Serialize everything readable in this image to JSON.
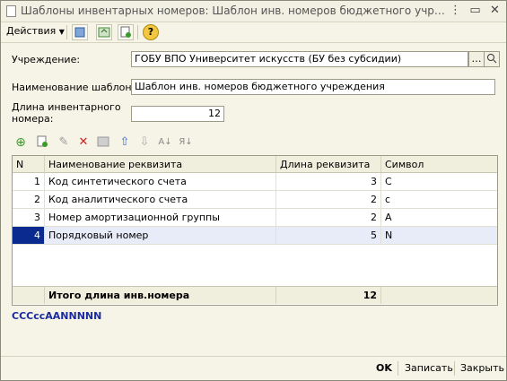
{
  "window": {
    "title": "Шаблоны инвентарных номеров: Шаблон инв. номеров бюджетного учрежден..."
  },
  "toolbar": {
    "actions_label": "Действия"
  },
  "form": {
    "institution_label": "Учреждение:",
    "institution_value": "ГОБУ ВПО Университет искусств (БУ без субсидии)",
    "template_name_label": "Наименование шаблона:",
    "template_name_value": "Шаблон инв. номеров бюджетного учреждения",
    "length_label_line1": "Длина инвентарного",
    "length_label_line2": "номера:",
    "length_value": "12"
  },
  "table": {
    "columns": [
      "N",
      "Наименование реквизита",
      "Длина реквизита",
      "Символ"
    ],
    "rows": [
      {
        "n": "1",
        "name": "Код синтетического счета",
        "length": "3",
        "symbol": "С"
      },
      {
        "n": "2",
        "name": "Код аналитического счета",
        "length": "2",
        "symbol": "с"
      },
      {
        "n": "3",
        "name": "Номер амортизационной группы",
        "length": "2",
        "symbol": "А"
      },
      {
        "n": "4",
        "name": "Порядковый номер",
        "length": "5",
        "symbol": "N"
      }
    ],
    "footer": {
      "label": "Итого длина инв.номера",
      "total": "12"
    }
  },
  "template_string": "СССссААNNNNN",
  "buttons": {
    "ok": "OK",
    "save": "Записать",
    "close": "Закрыть"
  },
  "colors": {
    "selection": "#0a2a8f",
    "row_highlight": "#e8ecf8",
    "template_text": "#1a2aa0",
    "accent_green": "#3a9a2a",
    "accent_red": "#d02020"
  }
}
